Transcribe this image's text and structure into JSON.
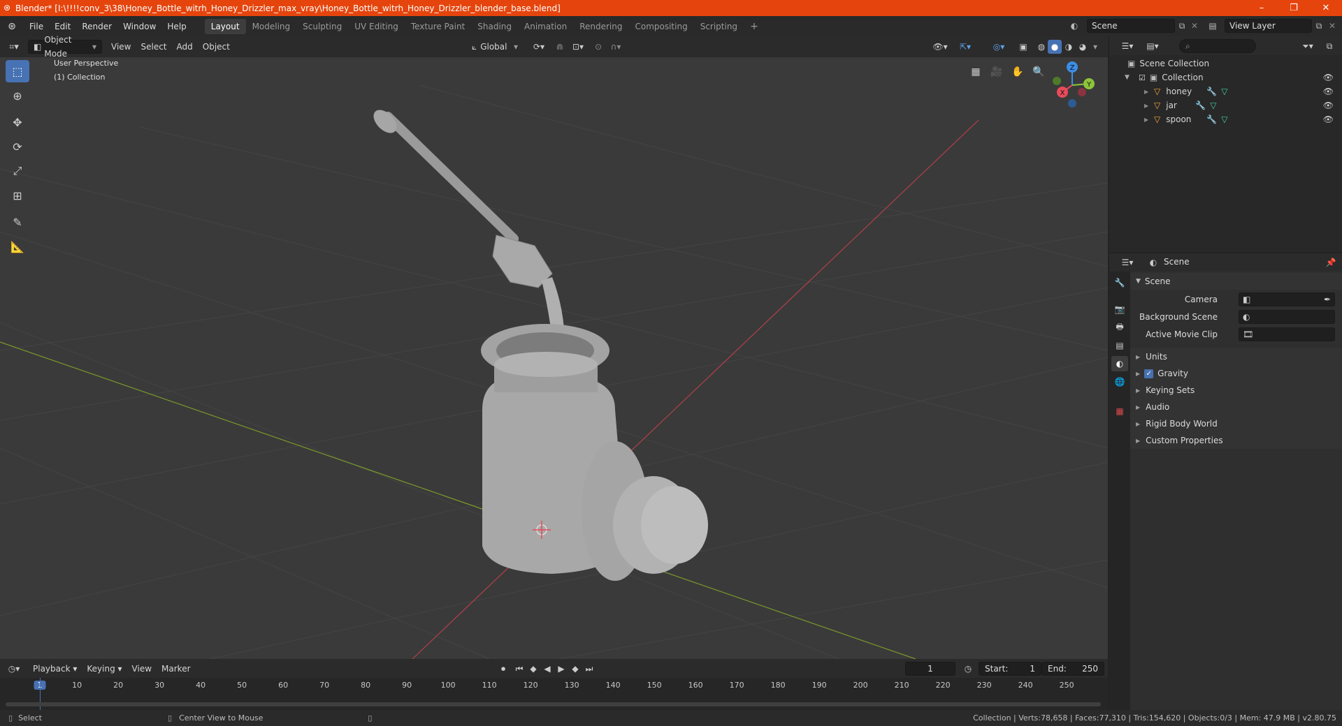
{
  "titlebar": {
    "title": "Blender* [I:\\!!!!conv_3\\38\\Honey_Bottle_witrh_Honey_Drizzler_max_vray\\Honey_Bottle_witrh_Honey_Drizzler_blender_base.blend]",
    "controls": [
      "–",
      "❐",
      "✕"
    ]
  },
  "menu": [
    "File",
    "Edit",
    "Render",
    "Window",
    "Help"
  ],
  "workspaces": {
    "tabs": [
      "Layout",
      "Modeling",
      "Sculpting",
      "UV Editing",
      "Texture Paint",
      "Shading",
      "Animation",
      "Rendering",
      "Compositing",
      "Scripting"
    ],
    "active": "Layout",
    "add": "+"
  },
  "scene_selector": {
    "value": "Scene"
  },
  "view_layer_selector": {
    "value": "View Layer"
  },
  "viewport_header": {
    "mode": "Object Mode",
    "menus": [
      "View",
      "Select",
      "Add",
      "Object"
    ],
    "orientation": "Global"
  },
  "viewport": {
    "perspective_label": "User Perspective",
    "collection_label": "(1) Collection",
    "gizmo": {
      "x": "X",
      "y": "Y",
      "z": "Z"
    }
  },
  "outliner": {
    "root": "Scene Collection",
    "collection": "Collection",
    "objects": [
      "honey",
      "jar",
      "spoon"
    ]
  },
  "properties": {
    "context": "Scene",
    "panel_title": "Scene",
    "fields": {
      "camera": "Camera",
      "background_scene": "Background Scene",
      "active_movie_clip": "Active Movie Clip"
    },
    "subpanels": [
      "Units",
      "Gravity",
      "Keying Sets",
      "Audio",
      "Rigid Body World",
      "Custom Properties"
    ],
    "gravity_checked": true
  },
  "timeline": {
    "menus": [
      "Playback",
      "Keying",
      "View",
      "Marker"
    ],
    "current_frame": "1",
    "start_label": "Start:",
    "start": "1",
    "end_label": "End:",
    "end": "250",
    "ticks": [
      "1",
      "10",
      "20",
      "30",
      "40",
      "50",
      "60",
      "70",
      "80",
      "90",
      "100",
      "110",
      "120",
      "130",
      "140",
      "150",
      "160",
      "170",
      "180",
      "190",
      "200",
      "210",
      "220",
      "230",
      "240",
      "250"
    ]
  },
  "statusbar": {
    "select": "Select",
    "center_view": "Center View to Mouse",
    "stats": "Collection | Verts:78,658 | Faces:77,310 | Tris:154,620 | Objects:0/3 | Mem: 47.9 MB | v2.80.75"
  },
  "colors": {
    "titlebar": "#e5450d",
    "accent": "#4772b3",
    "x_axis": "#e84b5a",
    "y_axis": "#8cc43a",
    "z_axis": "#3b8ee6",
    "object_icon": "#f3a63a",
    "modifier_icon": "#5ea2e8",
    "mesh_icon": "#3fd0a0"
  }
}
